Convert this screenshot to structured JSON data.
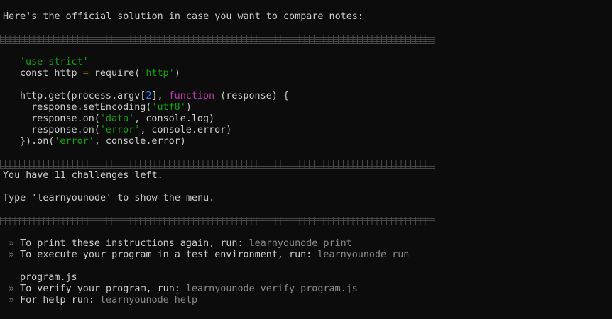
{
  "intro": "Here's the official solution in case you want to compare notes:",
  "code": {
    "line1": "'use strict'",
    "line2_const": "const http ",
    "line2_eq": "=",
    "line2_require": " require(",
    "line2_str": "'http'",
    "line2_close": ")",
    "line3_call": "http.get(process.argv[",
    "line3_index": "2",
    "line3_mid": "], ",
    "line3_fn": "function",
    "line3_end": " (response) {",
    "line4_pre": "  response.setEncoding(",
    "line4_str": "'utf8'",
    "line4_close": ")",
    "line5_pre": "  response.on(",
    "line5_str": "'data'",
    "line5_end": ", console.log)",
    "line6_pre": "  response.on(",
    "line6_str": "'error'",
    "line6_end": ", console.error)",
    "line7_pre": "}).on(",
    "line7_str": "'error'",
    "line7_end": ", console.error)"
  },
  "status": {
    "challenges_left": "You have 11 challenges left.",
    "menu_hint": "Type 'learnyounode' to show the menu."
  },
  "instructions": {
    "bullet": "»",
    "print_label": "To print these instructions again, run: ",
    "print_cmd": "learnyounode print",
    "run_label": "To execute your program in a test environment, run: ",
    "run_cmd": "learnyounode run",
    "run_arg": "program.js",
    "verify_label": "To verify your program, run: ",
    "verify_cmd": "learnyounode verify program.js",
    "help_label": "For help run: ",
    "help_cmd": "learnyounode help"
  },
  "colors": {
    "background": "#0c0c0c",
    "text": "#cccccc",
    "string": "#13a10e",
    "keyword": "#c239b3",
    "operator": "#c19c00",
    "number": "#3b78ff",
    "dim": "#8a8a8a"
  }
}
